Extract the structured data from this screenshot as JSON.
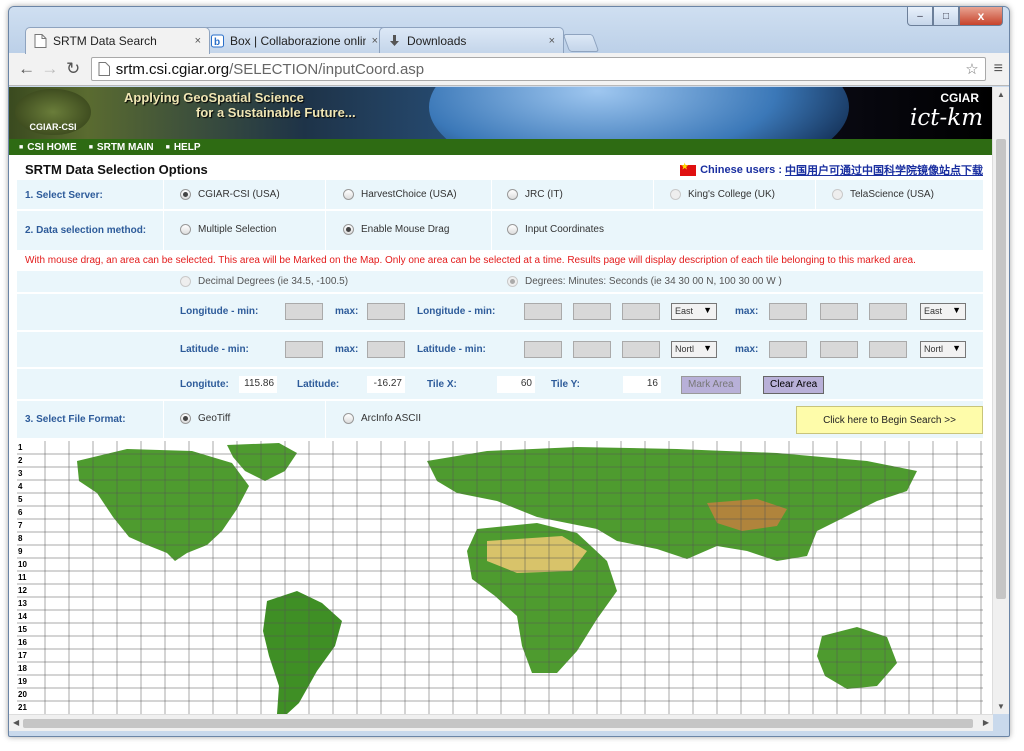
{
  "browser": {
    "tabs": [
      {
        "label": "SRTM Data Search",
        "close": "×",
        "active": true
      },
      {
        "label": "Box | Collaborazione onlin",
        "close": "×",
        "active": false
      },
      {
        "label": "Downloads",
        "close": "×",
        "active": false
      }
    ],
    "url_host": "srtm.csi.cgiar.org",
    "url_path": "/SELECTION/inputCoord.asp",
    "window_controls": {
      "minimize": "–",
      "maximize": "□",
      "close": "x"
    }
  },
  "banner": {
    "line1": "Applying GeoSpatial Science",
    "line2": "for a Sustainable Future...",
    "logo_text": "CGIAR-CSI",
    "org": "CGIAR",
    "brand": "ict-km"
  },
  "nav": [
    "CSI HOME",
    "SRTM MAIN",
    "HELP"
  ],
  "form": {
    "title": "SRTM Data Selection Options",
    "chinese_prefix": "Chinese users :",
    "chinese_link": "中国用户可通过中国科学院镜像站点下载",
    "server_label": "1. Select Server:",
    "servers": [
      "CGIAR-CSI (USA)",
      "HarvestChoice (USA)",
      "JRC (IT)",
      "King's College (UK)",
      "TelaScience (USA)"
    ],
    "method_label": "2. Data selection method:",
    "methods": [
      "Multiple Selection",
      "Enable Mouse Drag",
      "Input Coordinates"
    ],
    "message": "With mouse drag, an area can be selected. This area will be Marked on the Map. Only one area can be selected at a time. Results page will display description of each tile belonging to this marked area.",
    "decimal_option": "Decimal Degrees (ie 34.5, -100.5)",
    "dms_option": "Degrees: Minutes: Seconds (ie 34 30 00 N, 100 30 00 W )",
    "lon_min": "Longitude - min:",
    "lat_min": "Latitude - min:",
    "max": "max:",
    "east": "East",
    "north": "Nortl",
    "longitude_label": "Longitute:",
    "longitude_value": "115.86",
    "latitude_label": "Latitude:",
    "latitude_value": "-16.27",
    "tilex_label": "Tile X:",
    "tilex_value": "60",
    "tiley_label": "Tile Y:",
    "tiley_value": "16",
    "mark_area": "Mark Area",
    "clear_area": "Clear Area",
    "format_label": "3. Select File Format:",
    "formats": [
      "GeoTiff",
      "ArcInfo ASCII"
    ],
    "begin": "Click here to Begin Search >>"
  },
  "map": {
    "rows": [
      "1",
      "2",
      "3",
      "4",
      "5",
      "6",
      "7",
      "8",
      "9",
      "10",
      "11",
      "12",
      "13",
      "14",
      "15",
      "16",
      "17",
      "18",
      "19",
      "20",
      "21"
    ]
  },
  "colors": {
    "nav_green": "#2e6b13",
    "form_bg": "#eaf6fb",
    "label_blue": "#2d5b9a",
    "message_red": "#e31b1b",
    "go_yellow": "#fefcaa"
  }
}
